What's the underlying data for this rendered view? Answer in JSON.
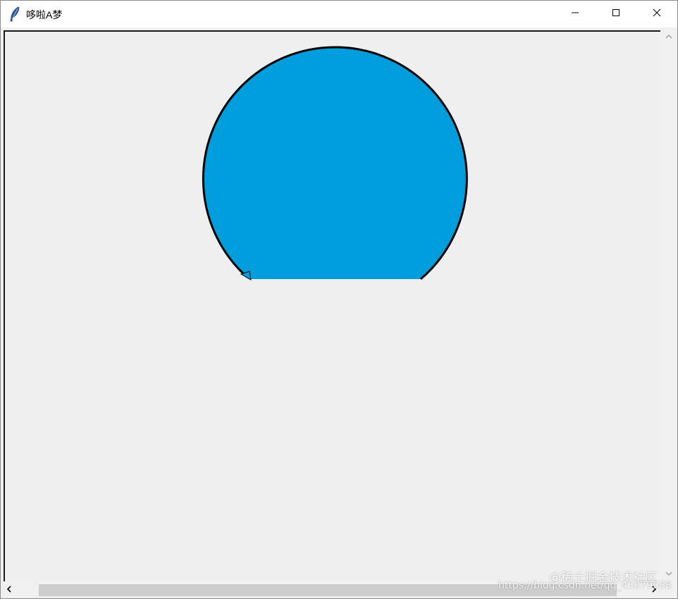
{
  "window": {
    "title": "哆啦A梦",
    "app_icon": "feather-icon",
    "controls": {
      "minimize_icon": "minimize-icon",
      "maximize_icon": "maximize-icon",
      "close_icon": "close-icon"
    }
  },
  "canvas": {
    "background": "#efefef",
    "drawing": {
      "shape": "circle-head",
      "fill_color": "#009ddc",
      "outline_color": "#000000"
    },
    "turtle_cursor": "turtle-arrow-icon"
  },
  "scrollbars": {
    "vertical": {
      "up_icon": "chevron-up-icon",
      "down_icon": "chevron-down-icon"
    },
    "horizontal": {
      "left_icon": "chevron-left-icon",
      "right_icon": "chevron-right-icon"
    }
  },
  "watermark": {
    "text": "@稀土掘金技术社区",
    "url": "https://blog.csdn.net/qq_45079588"
  }
}
